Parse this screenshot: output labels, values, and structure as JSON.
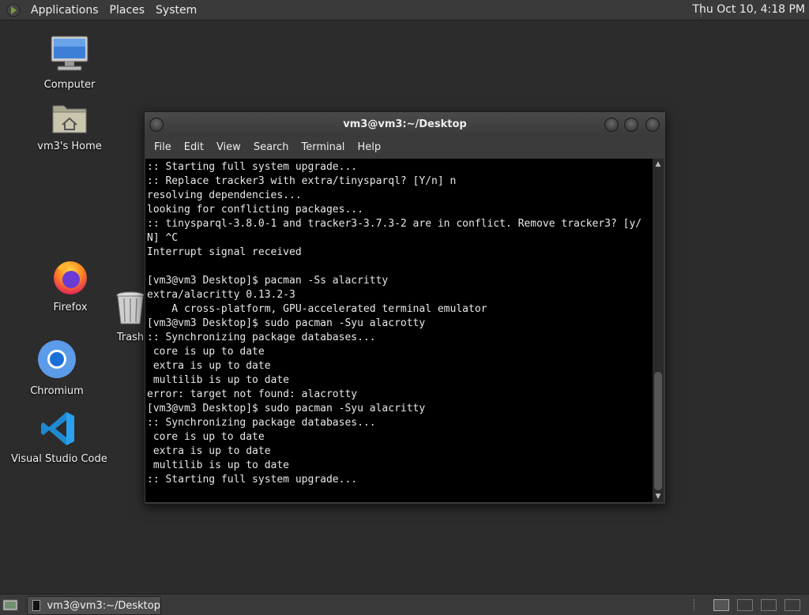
{
  "top_panel": {
    "menus": [
      "Applications",
      "Places",
      "System"
    ],
    "clock": "Thu Oct 10,  4:18 PM"
  },
  "desktop": {
    "icons": {
      "computer": "Computer",
      "home": "vm3's Home",
      "firefox": "Firefox",
      "trash": "Trash",
      "chromium": "Chromium",
      "vscode": "Visual Studio Code"
    }
  },
  "terminal": {
    "title": "vm3@vm3:~/Desktop",
    "menu": [
      "File",
      "Edit",
      "View",
      "Search",
      "Terminal",
      "Help"
    ],
    "lines": [
      ":: Starting full system upgrade...",
      ":: Replace tracker3 with extra/tinysparql? [Y/n] n",
      "resolving dependencies...",
      "looking for conflicting packages...",
      ":: tinysparql-3.8.0-1 and tracker3-3.7.3-2 are in conflict. Remove tracker3? [y/",
      "N] ^C",
      "Interrupt signal received",
      "",
      "[vm3@vm3 Desktop]$ pacman -Ss alacritty",
      "extra/alacritty 0.13.2-3",
      "    A cross-platform, GPU-accelerated terminal emulator",
      "[vm3@vm3 Desktop]$ sudo pacman -Syu alacrotty",
      ":: Synchronizing package databases...",
      " core is up to date",
      " extra is up to date",
      " multilib is up to date",
      "error: target not found: alacrotty",
      "[vm3@vm3 Desktop]$ sudo pacman -Syu alacritty",
      ":: Synchronizing package databases...",
      " core is up to date",
      " extra is up to date",
      " multilib is up to date",
      ":: Starting full system upgrade..."
    ]
  },
  "bottom_panel": {
    "task_label": "vm3@vm3:~/Desktop"
  },
  "colors": {
    "desktop_bg": "#2c2c2c",
    "panel_bg": "#3a3a3a",
    "terminal_bg": "#000000",
    "terminal_fg": "#e8e8e8"
  }
}
